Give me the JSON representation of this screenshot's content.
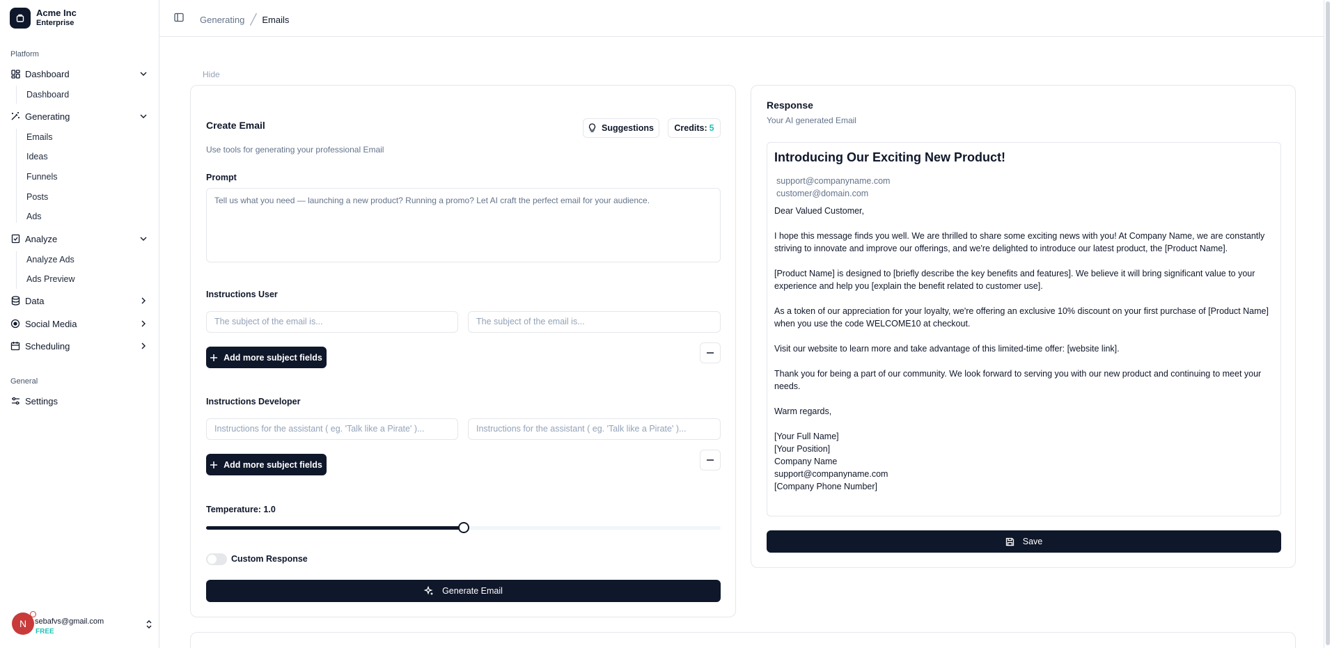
{
  "brand": {
    "name": "Acme Inc",
    "plan": "Enterprise"
  },
  "sidebar": {
    "platform_label": "Platform",
    "general_label": "General",
    "items": [
      {
        "label": "Dashboard",
        "icon": "dashboard-grid-icon",
        "expanded": true,
        "children": [
          "Dashboard"
        ]
      },
      {
        "label": "Generating",
        "icon": "wand-icon",
        "expanded": true,
        "children": [
          "Emails",
          "Ideas",
          "Funnels",
          "Posts",
          "Ads"
        ]
      },
      {
        "label": "Analyze",
        "icon": "clipboard-check-icon",
        "expanded": true,
        "children": [
          "Analyze Ads",
          "Ads Preview"
        ]
      },
      {
        "label": "Data",
        "icon": "database-icon",
        "expanded": false
      },
      {
        "label": "Social Media",
        "icon": "social-icon",
        "expanded": false
      },
      {
        "label": "Scheduling",
        "icon": "calendar-icon",
        "expanded": false
      }
    ],
    "settings_label": "Settings"
  },
  "user": {
    "initial": "N",
    "email": "sebafvs@gmail.com",
    "plan": "FREE"
  },
  "header": {
    "crumbs": [
      "Generating",
      "Emails"
    ]
  },
  "hide_label": "Hide",
  "form": {
    "title": "Create Email",
    "subtitle": "Use tools for generating your professional Email",
    "suggestions_label": "Suggestions",
    "credits_label": "Credits:",
    "credits_value": "5",
    "prompt_label": "Prompt",
    "prompt_placeholder": "Tell us what you need — launching a new product? Running a promo? Let AI craft the perfect email for your audience.",
    "instructions_user_label": "Instructions User",
    "subject_placeholder": "The subject of the email is...",
    "add_subject_label": "Add more subject fields",
    "instructions_dev_label": "Instructions Developer",
    "dev_placeholder": "Instructions for the assistant ( eg. 'Talk like a Pirate' )...",
    "temperature_label": "Temperature: 1.0",
    "temperature_value": 1.0,
    "temperature_fraction": 0.5,
    "custom_response_label": "Custom Response",
    "custom_response_on": false,
    "generate_label": "Generate Email"
  },
  "response": {
    "title": "Response",
    "subtitle": "Your AI generated Email",
    "subject": "Introducing Our Exciting New Product!",
    "from": "support@companyname.com",
    "to": "customer@domain.com",
    "greeting": "Dear Valued Customer,",
    "paragraphs": [
      "I hope this message finds you well. We are thrilled to share some exciting news with you! At Company Name, we are constantly striving to innovate and improve our offerings, and we're delighted to introduce our latest product, the [Product Name].",
      "[Product Name] is designed to [briefly describe the key benefits and features]. We believe it will bring significant value to your experience and help you [explain the benefit related to customer use].",
      "As a token of our appreciation for your loyalty, we're offering an exclusive 10% discount on your first purchase of [Product Name] when you use the code WELCOME10 at checkout.",
      "Visit our website to learn more and take advantage of this limited-time offer: [website link].",
      "Thank you for being a part of our community. We look forward to serving you with our new product and continuing to meet your needs.",
      "Warm regards,"
    ],
    "signature": [
      "[Your Full Name]",
      "[Your Position]",
      "Company Name",
      "support@companyname.com",
      "[Company Phone Number]"
    ],
    "save_label": "Save"
  }
}
